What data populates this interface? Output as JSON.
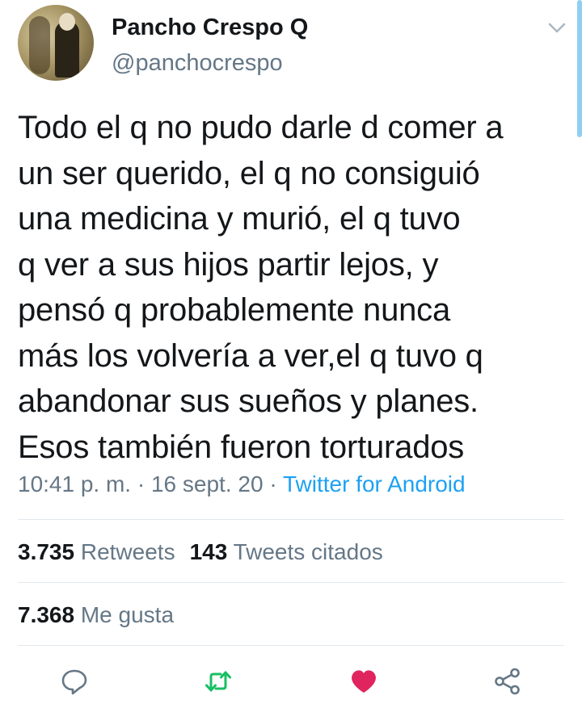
{
  "user": {
    "name": "Pancho Crespo Q",
    "handle": "@panchocrespo"
  },
  "tweet": {
    "text": "Todo el q no pudo darle d comer a\nun ser querido,  el q no consiguió\nuna medicina y murió, el q tuvo\nq ver a sus hijos partir lejos, y\npensó q probablemente nunca\nmás los volvería a ver,el q tuvo q\nabandonar sus sueños y planes.\nEsos también fueron torturados",
    "time": "10:41 p. m.",
    "sep1": " · ",
    "date": "16 sept. 20",
    "sep2": " · ",
    "source": "Twitter for Android"
  },
  "stats": {
    "retweets_count": "3.735",
    "retweets_label": "Retweets",
    "quotes_count": "143",
    "quotes_label": "Tweets citados",
    "likes_count": "7.368",
    "likes_label": "Me gusta"
  },
  "actions": {
    "reply_icon": "reply-icon",
    "retweet_icon": "retweet-icon",
    "like_icon": "heart-icon",
    "share_icon": "share-icon"
  },
  "colors": {
    "link": "#1da1f2",
    "secondary_text": "#657786",
    "retweet": "#17bf63",
    "like": "#e0245e"
  }
}
